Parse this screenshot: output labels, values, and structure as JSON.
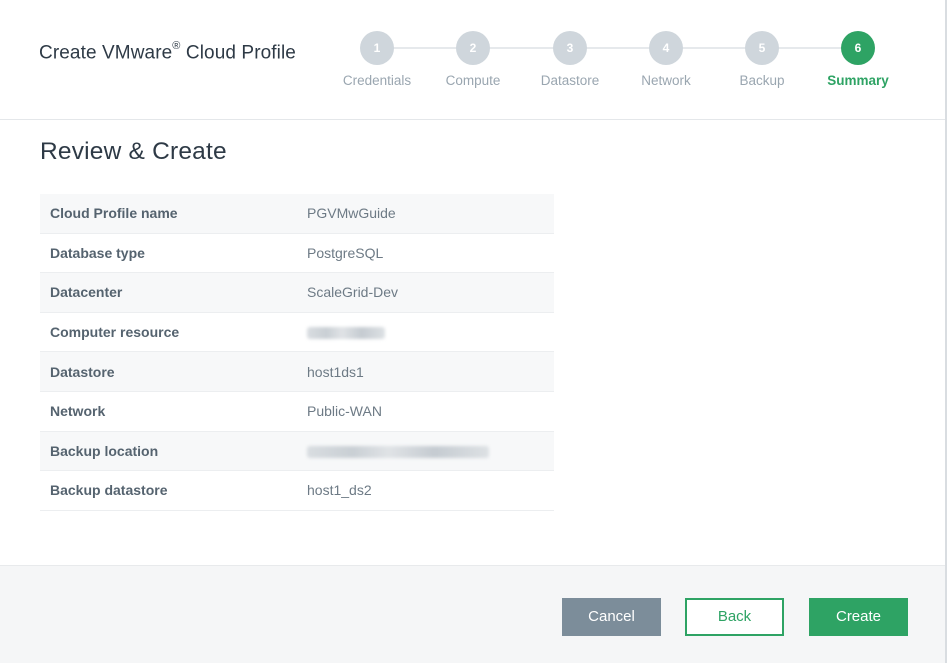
{
  "header": {
    "title": "Create VMware",
    "title_mark": "®",
    "title_suffix": " Cloud Profile"
  },
  "steps": [
    {
      "number": "1",
      "label": "Credentials",
      "active": false
    },
    {
      "number": "2",
      "label": "Compute",
      "active": false
    },
    {
      "number": "3",
      "label": "Datastore",
      "active": false
    },
    {
      "number": "4",
      "label": "Network",
      "active": false
    },
    {
      "number": "5",
      "label": "Backup",
      "active": false
    },
    {
      "number": "6",
      "label": "Summary",
      "active": true
    }
  ],
  "main": {
    "title": "Review & Create",
    "rows": [
      {
        "label": "Cloud Profile name",
        "value": "PGVMwGuide"
      },
      {
        "label": "Database type",
        "value": "PostgreSQL"
      },
      {
        "label": "Datacenter",
        "value": "ScaleGrid-Dev"
      },
      {
        "label": "Computer resource",
        "value": ""
      },
      {
        "label": "Datastore",
        "value": "host1ds1"
      },
      {
        "label": "Network",
        "value": "Public-WAN"
      },
      {
        "label": "Backup location",
        "value": ""
      },
      {
        "label": "Backup datastore",
        "value": "host1_ds2"
      }
    ]
  },
  "footer": {
    "cancel_label": "Cancel",
    "back_label": "Back",
    "create_label": "Create"
  },
  "colors": {
    "accent": "#2ea364",
    "inactive_step": "#cfd6dc",
    "cancel_button": "#7c8d9a"
  }
}
